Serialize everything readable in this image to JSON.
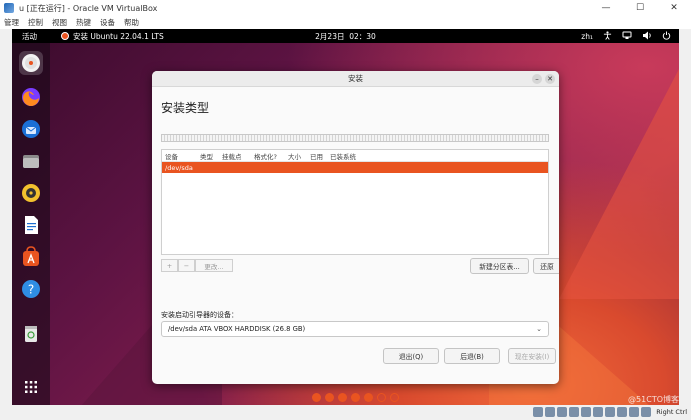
{
  "vbox": {
    "title": "u [正在运行] - Oracle VM VirtualBox",
    "menu": [
      "管理",
      "控制",
      "视图",
      "热键",
      "设备",
      "帮助"
    ],
    "controls": {
      "minimize": "—",
      "maximize": "☐",
      "close": "✕"
    },
    "status_hostkey": "Right Ctrl"
  },
  "gnome": {
    "activities": "活动",
    "app_name": "安装 Ubuntu 22.04.1 LTS",
    "clock": "2月23日  02：30",
    "input_method": "zh₁",
    "dock_items": [
      "ubuntu-installer",
      "firefox",
      "thunderbird",
      "files",
      "rhythmbox",
      "libreoffice-writer",
      "app-center",
      "help",
      "trash",
      "show-apps"
    ]
  },
  "installer": {
    "window_title": "安装",
    "heading": "安装类型",
    "columns": [
      "设备",
      "类型",
      "挂载点",
      "格式化?",
      "大小",
      "已用",
      "已装系统"
    ],
    "rows": [
      {
        "device": "/dev/sda"
      }
    ],
    "add_button": "+",
    "remove_button": "−",
    "change_button": "更改...",
    "new_table_button": "新建分区表...",
    "revert_button": "还原",
    "boot_label": "安装启动引导器的设备：",
    "boot_device": "/dev/sda ATA VBOX HARDDISK (26.8 GB)",
    "quit_button": "退出(Q)",
    "back_button": "后退(B)",
    "install_button": "现在安装(I)"
  },
  "progress": {
    "total_steps": 7,
    "completed_steps": 5
  },
  "watermark": "@51CTO博客",
  "colors": {
    "accent": "#e95420",
    "topbar": "#000000"
  }
}
